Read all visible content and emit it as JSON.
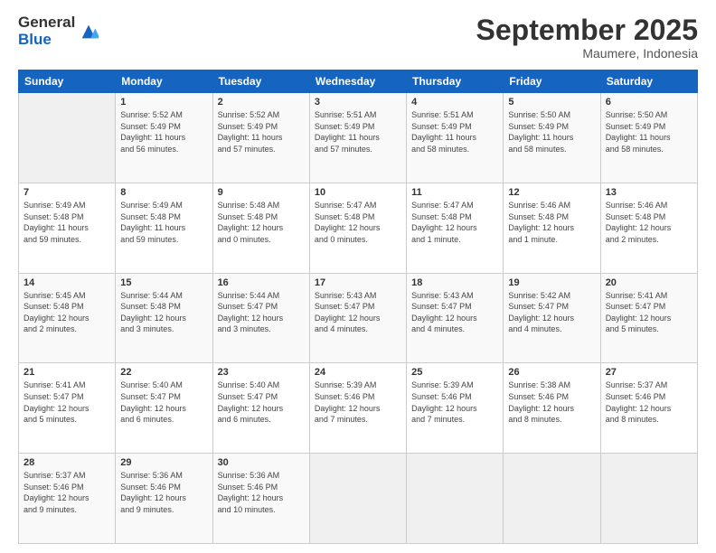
{
  "logo": {
    "general": "General",
    "blue": "Blue"
  },
  "header": {
    "title": "September 2025",
    "location": "Maumere, Indonesia"
  },
  "columns": [
    "Sunday",
    "Monday",
    "Tuesday",
    "Wednesday",
    "Thursday",
    "Friday",
    "Saturday"
  ],
  "weeks": [
    [
      {
        "day": "",
        "info": ""
      },
      {
        "day": "1",
        "info": "Sunrise: 5:52 AM\nSunset: 5:49 PM\nDaylight: 11 hours\nand 56 minutes."
      },
      {
        "day": "2",
        "info": "Sunrise: 5:52 AM\nSunset: 5:49 PM\nDaylight: 11 hours\nand 57 minutes."
      },
      {
        "day": "3",
        "info": "Sunrise: 5:51 AM\nSunset: 5:49 PM\nDaylight: 11 hours\nand 57 minutes."
      },
      {
        "day": "4",
        "info": "Sunrise: 5:51 AM\nSunset: 5:49 PM\nDaylight: 11 hours\nand 58 minutes."
      },
      {
        "day": "5",
        "info": "Sunrise: 5:50 AM\nSunset: 5:49 PM\nDaylight: 11 hours\nand 58 minutes."
      },
      {
        "day": "6",
        "info": "Sunrise: 5:50 AM\nSunset: 5:49 PM\nDaylight: 11 hours\nand 58 minutes."
      }
    ],
    [
      {
        "day": "7",
        "info": "Sunrise: 5:49 AM\nSunset: 5:48 PM\nDaylight: 11 hours\nand 59 minutes."
      },
      {
        "day": "8",
        "info": "Sunrise: 5:49 AM\nSunset: 5:48 PM\nDaylight: 11 hours\nand 59 minutes."
      },
      {
        "day": "9",
        "info": "Sunrise: 5:48 AM\nSunset: 5:48 PM\nDaylight: 12 hours\nand 0 minutes."
      },
      {
        "day": "10",
        "info": "Sunrise: 5:47 AM\nSunset: 5:48 PM\nDaylight: 12 hours\nand 0 minutes."
      },
      {
        "day": "11",
        "info": "Sunrise: 5:47 AM\nSunset: 5:48 PM\nDaylight: 12 hours\nand 1 minute."
      },
      {
        "day": "12",
        "info": "Sunrise: 5:46 AM\nSunset: 5:48 PM\nDaylight: 12 hours\nand 1 minute."
      },
      {
        "day": "13",
        "info": "Sunrise: 5:46 AM\nSunset: 5:48 PM\nDaylight: 12 hours\nand 2 minutes."
      }
    ],
    [
      {
        "day": "14",
        "info": "Sunrise: 5:45 AM\nSunset: 5:48 PM\nDaylight: 12 hours\nand 2 minutes."
      },
      {
        "day": "15",
        "info": "Sunrise: 5:44 AM\nSunset: 5:48 PM\nDaylight: 12 hours\nand 3 minutes."
      },
      {
        "day": "16",
        "info": "Sunrise: 5:44 AM\nSunset: 5:47 PM\nDaylight: 12 hours\nand 3 minutes."
      },
      {
        "day": "17",
        "info": "Sunrise: 5:43 AM\nSunset: 5:47 PM\nDaylight: 12 hours\nand 4 minutes."
      },
      {
        "day": "18",
        "info": "Sunrise: 5:43 AM\nSunset: 5:47 PM\nDaylight: 12 hours\nand 4 minutes."
      },
      {
        "day": "19",
        "info": "Sunrise: 5:42 AM\nSunset: 5:47 PM\nDaylight: 12 hours\nand 4 minutes."
      },
      {
        "day": "20",
        "info": "Sunrise: 5:41 AM\nSunset: 5:47 PM\nDaylight: 12 hours\nand 5 minutes."
      }
    ],
    [
      {
        "day": "21",
        "info": "Sunrise: 5:41 AM\nSunset: 5:47 PM\nDaylight: 12 hours\nand 5 minutes."
      },
      {
        "day": "22",
        "info": "Sunrise: 5:40 AM\nSunset: 5:47 PM\nDaylight: 12 hours\nand 6 minutes."
      },
      {
        "day": "23",
        "info": "Sunrise: 5:40 AM\nSunset: 5:47 PM\nDaylight: 12 hours\nand 6 minutes."
      },
      {
        "day": "24",
        "info": "Sunrise: 5:39 AM\nSunset: 5:46 PM\nDaylight: 12 hours\nand 7 minutes."
      },
      {
        "day": "25",
        "info": "Sunrise: 5:39 AM\nSunset: 5:46 PM\nDaylight: 12 hours\nand 7 minutes."
      },
      {
        "day": "26",
        "info": "Sunrise: 5:38 AM\nSunset: 5:46 PM\nDaylight: 12 hours\nand 8 minutes."
      },
      {
        "day": "27",
        "info": "Sunrise: 5:37 AM\nSunset: 5:46 PM\nDaylight: 12 hours\nand 8 minutes."
      }
    ],
    [
      {
        "day": "28",
        "info": "Sunrise: 5:37 AM\nSunset: 5:46 PM\nDaylight: 12 hours\nand 9 minutes."
      },
      {
        "day": "29",
        "info": "Sunrise: 5:36 AM\nSunset: 5:46 PM\nDaylight: 12 hours\nand 9 minutes."
      },
      {
        "day": "30",
        "info": "Sunrise: 5:36 AM\nSunset: 5:46 PM\nDaylight: 12 hours\nand 10 minutes."
      },
      {
        "day": "",
        "info": ""
      },
      {
        "day": "",
        "info": ""
      },
      {
        "day": "",
        "info": ""
      },
      {
        "day": "",
        "info": ""
      }
    ]
  ]
}
